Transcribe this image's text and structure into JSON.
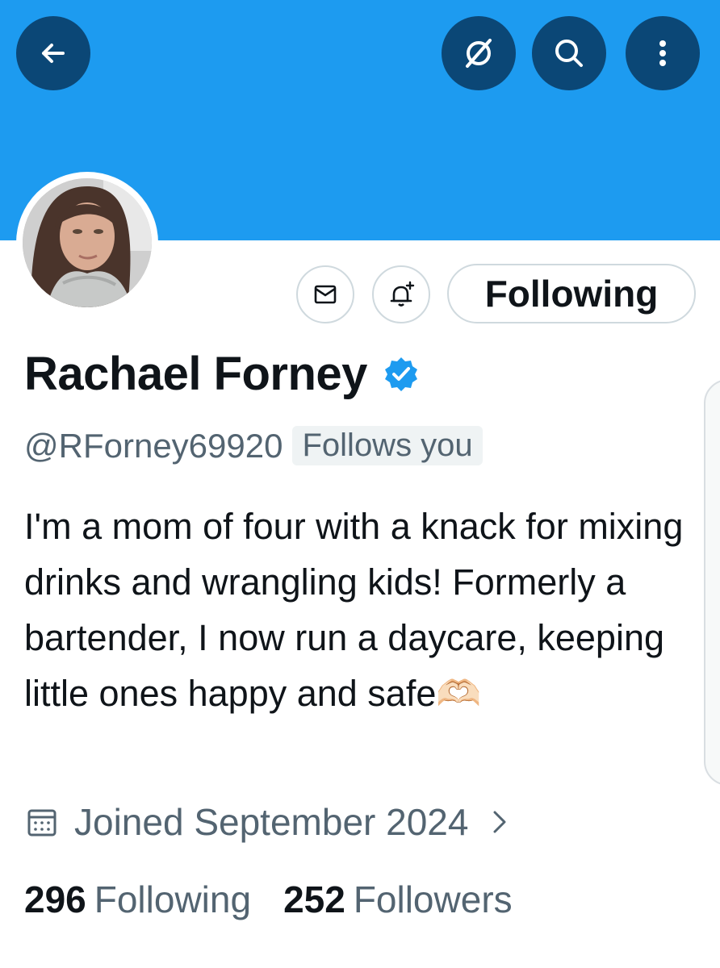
{
  "header": {
    "back_icon": "arrow-left-icon",
    "grok_icon": "grok-icon",
    "search_icon": "search-icon",
    "more_icon": "more-vertical-icon",
    "banner_color": "#1d9bf0",
    "button_color": "#0b4776"
  },
  "profile": {
    "avatar_icon": "profile-photo",
    "message_icon": "envelope-icon",
    "notify_icon": "bell-plus-icon",
    "following_button_label": "Following",
    "name": "Rachael Forney",
    "verified_icon": "verified-badge-icon",
    "verified_color": "#1d9bf0",
    "handle": "@RForney69920",
    "follows_you": "Follows you",
    "bio": "I'm a mom of four with a knack for mixing drinks and wrangling kids! Formerly a bartender, I now run a daycare, keeping little ones happy and safe🫶🏻",
    "joined_icon": "calendar-icon",
    "joined": "Joined September 2024",
    "joined_chevron": "chevron-right-icon"
  },
  "stats": {
    "following_count": "296",
    "following_label": "Following",
    "followers_count": "252",
    "followers_label": "Followers"
  }
}
